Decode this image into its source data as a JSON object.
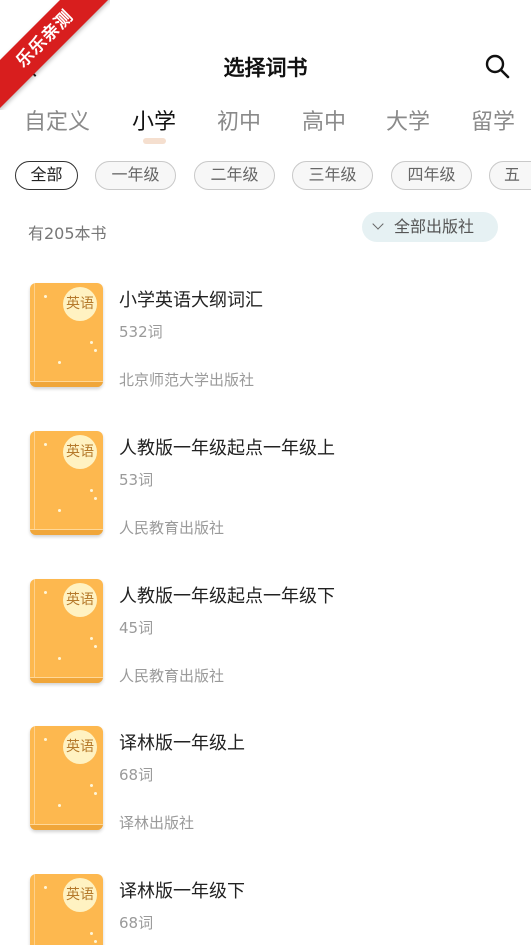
{
  "ribbon": {
    "text": "乐乐亲测"
  },
  "header": {
    "title": "选择词书"
  },
  "tabs": [
    {
      "label": "自定义"
    },
    {
      "label": "小学"
    },
    {
      "label": "初中"
    },
    {
      "label": "高中"
    },
    {
      "label": "大学"
    },
    {
      "label": "留学"
    }
  ],
  "grades": [
    {
      "label": "全部"
    },
    {
      "label": "一年级"
    },
    {
      "label": "二年级"
    },
    {
      "label": "三年级"
    },
    {
      "label": "四年级"
    },
    {
      "label": "五"
    }
  ],
  "summary": {
    "count_text": "有205本书",
    "publisher_filter": "全部出版社"
  },
  "books": [
    {
      "badge": "英语",
      "name": "小学英语大纲词汇",
      "words": "532词",
      "publisher": "北京师范大学出版社"
    },
    {
      "badge": "英语",
      "name": "人教版一年级起点一年级上",
      "words": "53词",
      "publisher": "人民教育出版社"
    },
    {
      "badge": "英语",
      "name": "人教版一年级起点一年级下",
      "words": "45词",
      "publisher": "人民教育出版社"
    },
    {
      "badge": "英语",
      "name": "译林版一年级上",
      "words": "68词",
      "publisher": "译林出版社"
    },
    {
      "badge": "英语",
      "name": "译林版一年级下",
      "words": "68词",
      "publisher": ""
    }
  ]
}
